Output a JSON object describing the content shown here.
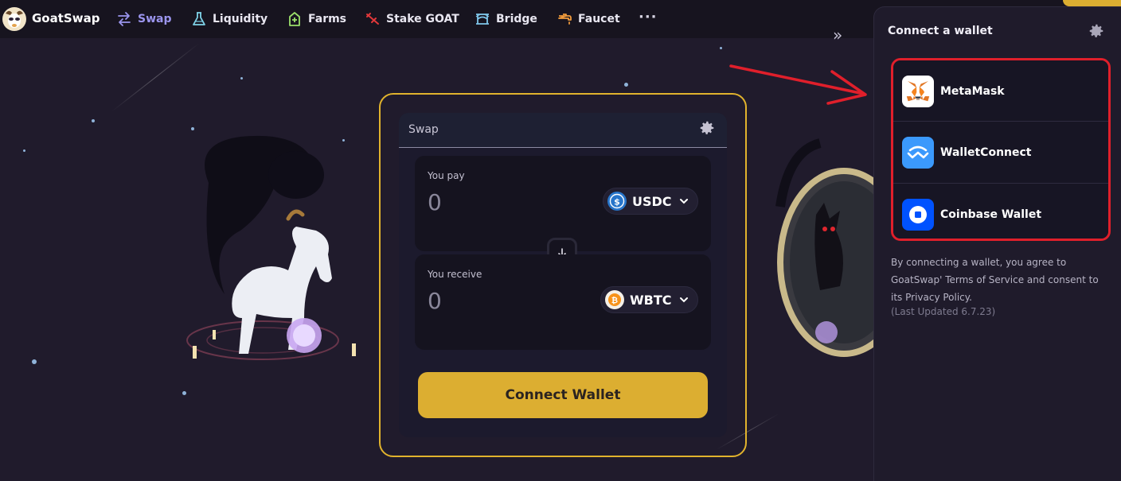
{
  "brand": {
    "name": "GoatSwap"
  },
  "nav": {
    "items": [
      {
        "label": "Swap",
        "icon": "swap-arrows-icon",
        "active": true
      },
      {
        "label": "Liquidity",
        "icon": "flask-icon",
        "active": false
      },
      {
        "label": "Farms",
        "icon": "farm-plant-icon",
        "active": false
      },
      {
        "label": "Stake GOAT",
        "icon": "stake-icon",
        "active": false
      },
      {
        "label": "Bridge",
        "icon": "bridge-icon",
        "active": false
      },
      {
        "label": "Faucet",
        "icon": "faucet-icon",
        "active": false
      }
    ],
    "more": "···",
    "collapse": "»"
  },
  "swap": {
    "title": "Swap",
    "pay": {
      "label": "You pay",
      "amount_placeholder": "0",
      "token": "USDC"
    },
    "receive": {
      "label": "You receive",
      "amount_placeholder": "0",
      "token": "WBTC"
    },
    "connect_label": "Connect Wallet"
  },
  "wallet_drawer": {
    "title": "Connect a wallet",
    "wallets": [
      {
        "name": "MetaMask",
        "icon": "metamask-fox-icon"
      },
      {
        "name": "WalletConnect",
        "icon": "walletconnect-icon"
      },
      {
        "name": "Coinbase Wallet",
        "icon": "coinbase-wallet-icon"
      }
    ],
    "legal_text": "By connecting a wallet, you agree to GoatSwap' Terms of Service and consent to its Privacy Policy.",
    "last_updated": "(Last Updated 6.7.23)"
  },
  "colors": {
    "accent": "#dcae31",
    "nav_active": "#9b95ee",
    "highlight_box": "#e01f2b",
    "background": "#201b2c"
  }
}
